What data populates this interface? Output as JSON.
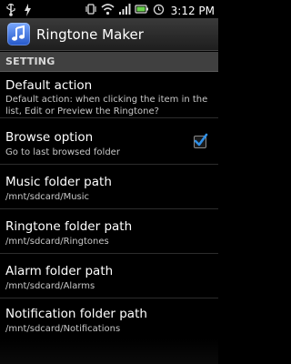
{
  "status_bar": {
    "time": "3:12 PM",
    "left_icons": [
      "usb-icon",
      "lightning-icon"
    ],
    "right_icons": [
      "vibrate-icon",
      "wifi-icon",
      "signal-icon",
      "battery-icon",
      "alarm-icon"
    ]
  },
  "app": {
    "title": "Ringtone Maker",
    "icon": "music-note-icon"
  },
  "section": {
    "header": "SETTING"
  },
  "preferences": [
    {
      "title": "Default action",
      "summary_line1": "Default action: when clicking the item in the",
      "summary_line2": "list, Edit or Preview the Ringtone?"
    },
    {
      "title": "Browse option",
      "summary": "Go to last browsed folder",
      "checked": true
    },
    {
      "title": "Music folder path",
      "summary": "/mnt/sdcard/Music"
    },
    {
      "title": "Ringtone folder path",
      "summary": "/mnt/sdcard/Ringtones"
    },
    {
      "title": "Alarm folder path",
      "summary": "/mnt/sdcard/Alarms"
    },
    {
      "title": "Notification folder path",
      "summary": "/mnt/sdcard/Notifications"
    }
  ],
  "colors": {
    "checkmark": "#2f8fe6",
    "section_bg": "#404040",
    "background": "#000000"
  }
}
